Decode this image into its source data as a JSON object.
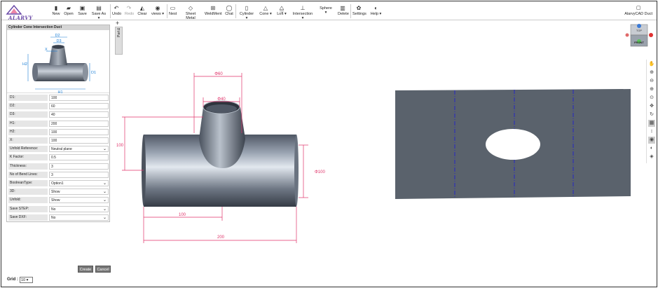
{
  "app": {
    "brand": "ALARVY",
    "product": "AlarvyCAD Duct"
  },
  "toolbar": {
    "new": "New",
    "open": "Open",
    "save": "Save",
    "save_as": "Save As",
    "undo": "Undo",
    "redo": "Redo",
    "clear": "Clear",
    "views": "views",
    "nest": "Nest",
    "sheet_metal": "Sheet Metal",
    "weldment": "WeldMent",
    "chat": "Chat",
    "cylinder": "Cylinder",
    "cone": "Cone",
    "loft": "Loft",
    "intersection": "Intersection",
    "sphere": "Sphere",
    "delete": "Delete",
    "settings": "Settings",
    "help": "Help"
  },
  "panel": {
    "title": "Cylinder Cone Intersection Duct",
    "preview_labels": {
      "d1": "D1",
      "d2": "D2",
      "d3": "D3",
      "h1": "H1",
      "h2": "H2",
      "x": "X"
    },
    "fields": [
      {
        "label": "D1:",
        "value": "100",
        "dropdown": false
      },
      {
        "label": "D2:",
        "value": "60",
        "dropdown": false
      },
      {
        "label": "D3:",
        "value": "40",
        "dropdown": false
      },
      {
        "label": "H1:",
        "value": "200",
        "dropdown": false
      },
      {
        "label": "H2:",
        "value": "100",
        "dropdown": false
      },
      {
        "label": "X:",
        "value": "100",
        "dropdown": false
      },
      {
        "label": "Unfold Reference:",
        "value": "Neutral plane",
        "dropdown": true
      },
      {
        "label": "K Factor:",
        "value": "0.5",
        "dropdown": false
      },
      {
        "label": "Thickness:",
        "value": "3",
        "dropdown": false
      },
      {
        "label": "No of Bend Lines:",
        "value": "3",
        "dropdown": false
      },
      {
        "label": "BoolreanType:",
        "value": "Option1",
        "dropdown": true
      },
      {
        "label": "3D:",
        "value": "Show",
        "dropdown": true
      },
      {
        "label": "Unfold:",
        "value": "Show",
        "dropdown": true
      },
      {
        "label": "Save STEP:",
        "value": "No",
        "dropdown": true
      },
      {
        "label": "Save DXF:",
        "value": "No",
        "dropdown": true
      }
    ],
    "create": "Create",
    "cancel": "Cancel"
  },
  "grid": {
    "label": "Grid :",
    "value": "10"
  },
  "tabs": {
    "plus": "+",
    "part": "Part 1",
    "close": "×"
  },
  "dims": {
    "d60": "Φ60",
    "d40": "Φ40",
    "h100": "100",
    "d100": "Φ100",
    "x100": "100",
    "len200": "200"
  },
  "viewcube": {
    "top": "TOP",
    "front": "FRONT"
  },
  "colors": {
    "accent": "#6b4aa8",
    "dim": "#e0336a",
    "sheet": "#5a626c",
    "bend": "#1a1adb"
  }
}
